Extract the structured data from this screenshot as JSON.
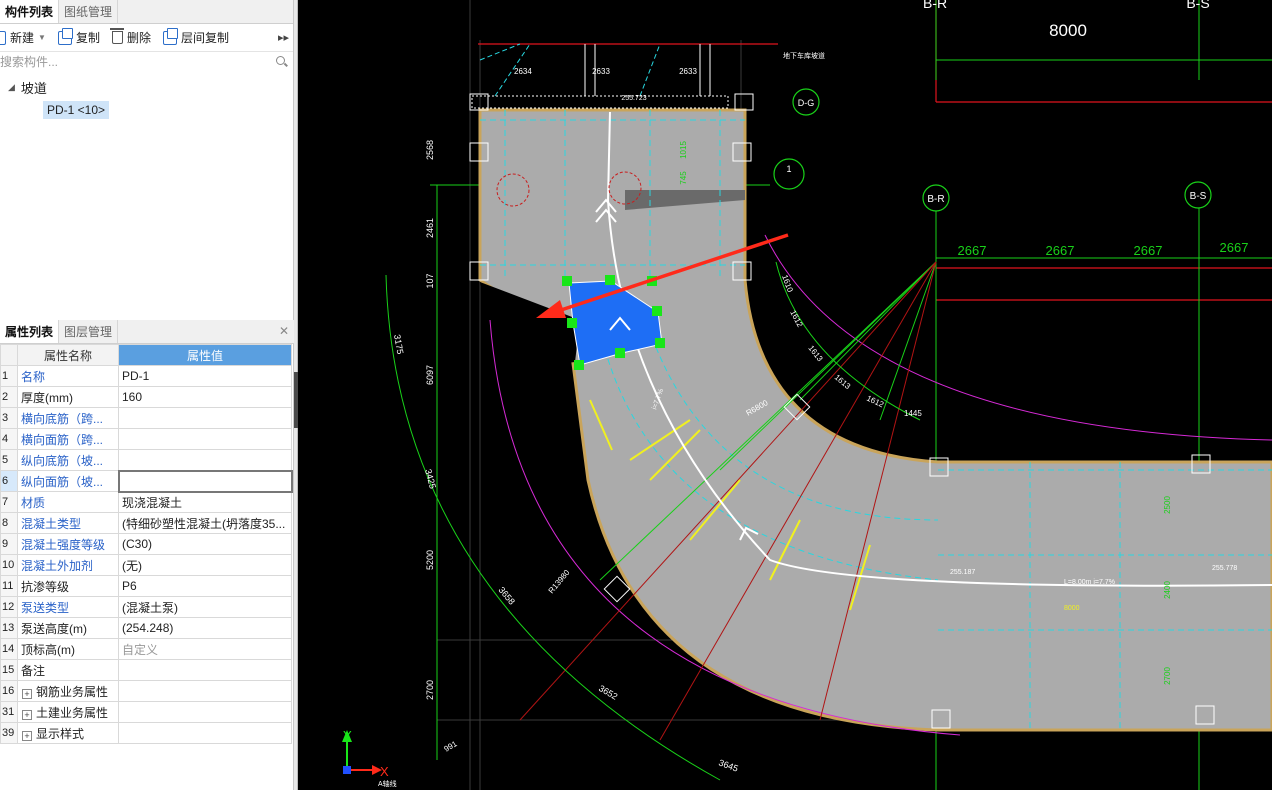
{
  "component_panel": {
    "tabs": [
      "构件列表",
      "图纸管理"
    ],
    "toolbar": {
      "new": "新建",
      "copy": "复制",
      "delete": "删除",
      "floor_copy": "层间复制"
    },
    "search_placeholder": "搜索构件...",
    "tree": {
      "category": "坡道",
      "item": "PD-1 <10>"
    }
  },
  "property_panel": {
    "tabs": [
      "属性列表",
      "图层管理"
    ],
    "headers": {
      "name": "属性名称",
      "value": "属性值"
    },
    "rows": [
      {
        "num": "1",
        "name": "名称",
        "value": "PD-1",
        "blue": true
      },
      {
        "num": "2",
        "name": "厚度(mm)",
        "value": "160",
        "blue": false
      },
      {
        "num": "3",
        "name": "横向底筋（跨...",
        "value": "",
        "blue": true
      },
      {
        "num": "4",
        "name": "横向面筋（跨...",
        "value": "",
        "blue": true
      },
      {
        "num": "5",
        "name": "纵向底筋（坡...",
        "value": "",
        "blue": true
      },
      {
        "num": "6",
        "name": "纵向面筋（坡...",
        "value": "",
        "blue": true
      },
      {
        "num": "7",
        "name": "材质",
        "value": "现浇混凝土",
        "blue": true
      },
      {
        "num": "8",
        "name": "混凝土类型",
        "value": "(特细砂塑性混凝土(坍落度35...",
        "blue": true
      },
      {
        "num": "9",
        "name": "混凝土强度等级",
        "value": "(C30)",
        "blue": true
      },
      {
        "num": "10",
        "name": "混凝土外加剂",
        "value": "(无)",
        "blue": true
      },
      {
        "num": "11",
        "name": "抗渗等级",
        "value": "P6",
        "blue": false
      },
      {
        "num": "12",
        "name": "泵送类型",
        "value": "(混凝土泵)",
        "blue": true
      },
      {
        "num": "13",
        "name": "泵送高度(m)",
        "value": "(254.248)",
        "blue": false
      },
      {
        "num": "14",
        "name": "顶标高(m)",
        "value": "自定义",
        "blue": false
      },
      {
        "num": "15",
        "name": "备注",
        "value": "",
        "blue": false
      },
      {
        "num": "16",
        "name": "钢筋业务属性",
        "value": "",
        "blue": false
      },
      {
        "num": "31",
        "name": "土建业务属性",
        "value": "",
        "blue": false
      },
      {
        "num": "39",
        "name": "显示样式",
        "value": "",
        "blue": false
      }
    ]
  },
  "cad": {
    "axis_labels": {
      "br": "B-R",
      "bs": "B-S",
      "dg": "D-G",
      "detail": "1"
    },
    "dim_top": "8000",
    "dims_right": [
      "2667",
      "2667",
      "2667",
      "2667"
    ],
    "dims_top_left": [
      "2634",
      "2633",
      "2633"
    ],
    "dims_left_vertical": [
      "2568",
      "2461",
      "107",
      "6097",
      "5200",
      "2700"
    ],
    "arc_dims_outer": [
      "3175",
      "3425",
      "3658",
      "3652",
      "3645"
    ],
    "arc_dims_inner": [
      "1610",
      "1612",
      "1613",
      "1613",
      "1612",
      "1445"
    ],
    "slab_dims": [
      "1015",
      "745",
      "2500",
      "2400",
      "2700"
    ],
    "radius_labels": [
      "R6800",
      "R13980"
    ],
    "slope_labels": [
      "i=7.7%",
      "L=8.00m i=7.7%",
      "8000"
    ],
    "elevations": [
      "255.187",
      "255.778"
    ],
    "other_labels": [
      "255.723",
      "地下车库坡道",
      "991",
      "A轴线",
      "X",
      "Y"
    ]
  }
}
